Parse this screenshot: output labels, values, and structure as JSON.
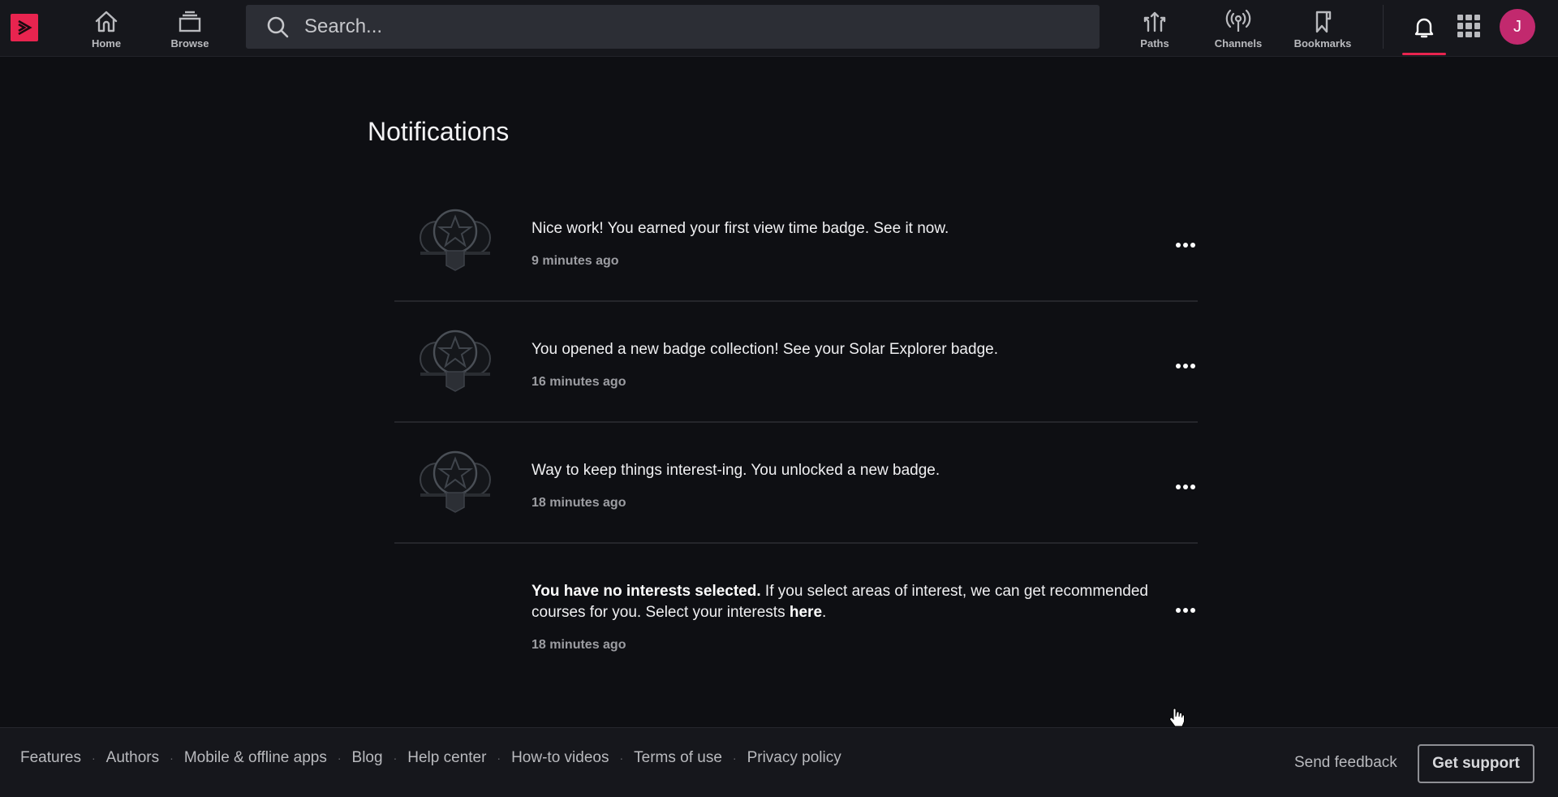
{
  "header": {
    "logo_icon": "play-logo-icon",
    "nav_left": [
      {
        "label": "Home",
        "icon": "home-icon"
      },
      {
        "label": "Browse",
        "icon": "browse-stack-icon"
      }
    ],
    "search": {
      "placeholder": "Search...",
      "value": "",
      "icon": "search-icon"
    },
    "nav_right": [
      {
        "label": "Paths",
        "icon": "paths-arrows-icon"
      },
      {
        "label": "Channels",
        "icon": "broadcast-icon"
      },
      {
        "label": "Bookmarks",
        "icon": "bookmark-icon"
      }
    ],
    "notifications_icon": "bell-icon",
    "apps_icon": "grid-apps-icon",
    "avatar_initial": "J",
    "accent_color": "#e8244f",
    "avatar_color": "#c2296e"
  },
  "main": {
    "title": "Notifications",
    "notifications": [
      {
        "text": "Nice work! You earned your first view time badge. See it now.",
        "time": "9 minutes ago",
        "has_badge": true
      },
      {
        "text": "You opened a new badge collection! See your Solar Explorer badge.",
        "time": "16 minutes ago",
        "has_badge": true
      },
      {
        "text": "Way to keep things interest-ing. You unlocked a new badge.",
        "time": "18 minutes ago",
        "has_badge": true
      },
      {
        "text_bold": "You have no interests selected.",
        "text": " If you select areas of interest, we can get recommended courses for you. Select your interests ",
        "link": "here",
        "text_end": ".",
        "time": "18 minutes ago",
        "has_badge": false
      }
    ],
    "more_icon": "more-horizontal-icon"
  },
  "footer": {
    "links": [
      "Features",
      "Authors",
      "Mobile & offline apps",
      "Blog",
      "Help center",
      "How-to videos",
      "Terms of use",
      "Privacy policy"
    ],
    "separator": "·",
    "send_feedback": "Send feedback",
    "get_support": "Get support"
  }
}
